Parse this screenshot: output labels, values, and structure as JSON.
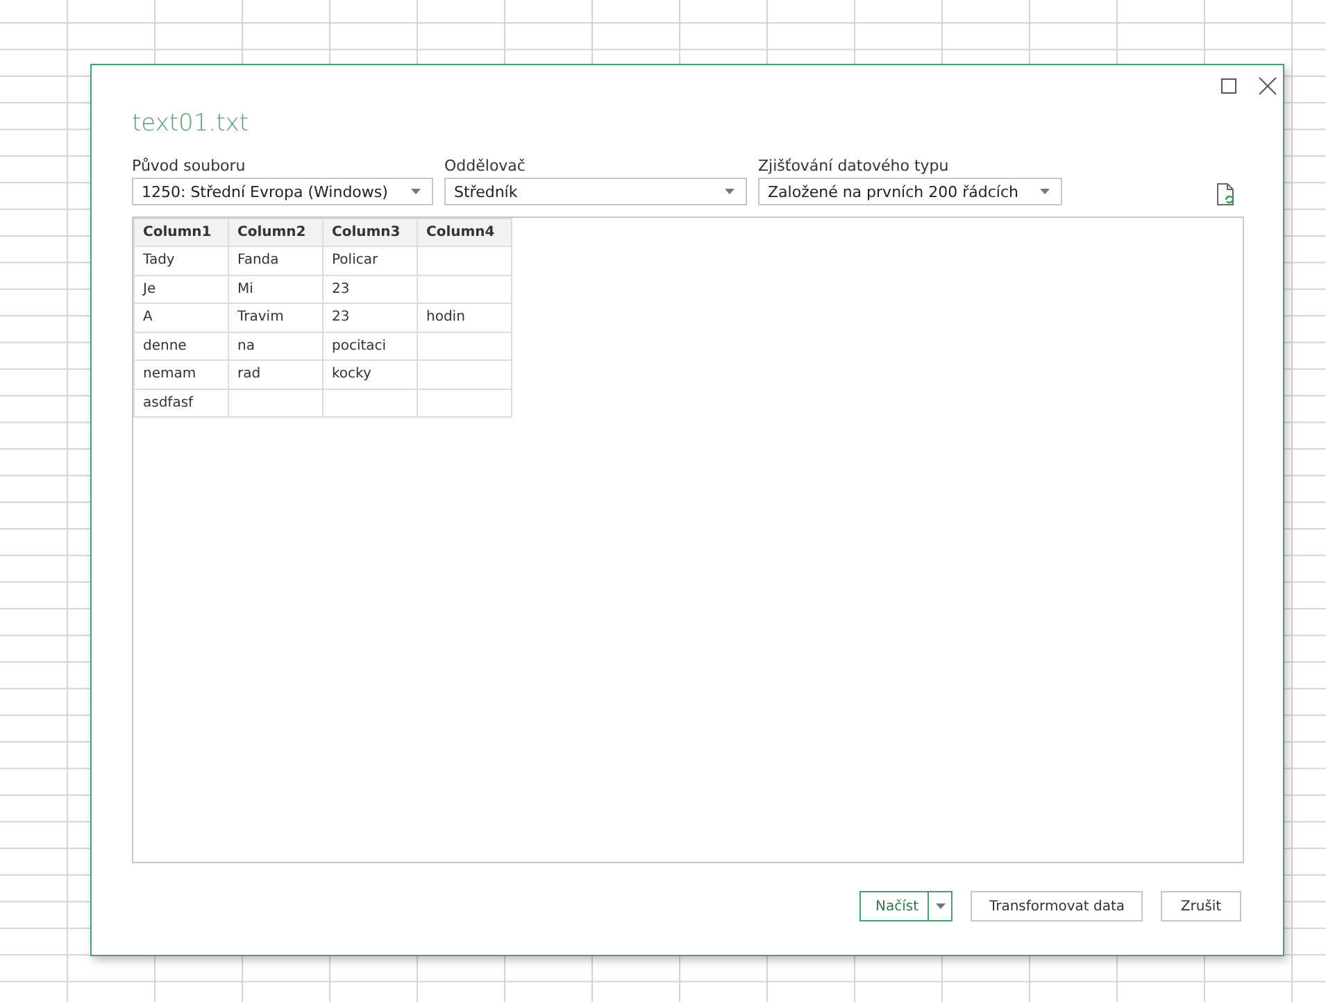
{
  "dialog": {
    "title": "text01.txt",
    "fields": [
      {
        "label": "Původ souboru",
        "value": "1250: Střední Evropa (Windows)"
      },
      {
        "label": "Oddělovač",
        "value": "Středník"
      },
      {
        "label": "Zjišťování datového typu",
        "value": "Založené na prvních 200 řádcích"
      }
    ],
    "table": {
      "columns": [
        "Column1",
        "Column2",
        "Column3",
        "Column4"
      ],
      "rows": [
        [
          "Tady",
          "Fanda",
          "Policar",
          ""
        ],
        [
          "Je",
          "Mi",
          "23",
          ""
        ],
        [
          "A",
          "Travim",
          "23",
          "hodin"
        ],
        [
          "denne",
          "na",
          "pocitaci",
          ""
        ],
        [
          "nemam",
          "rad",
          "kocky",
          ""
        ],
        [
          "asdfasf",
          "",
          "",
          ""
        ]
      ]
    },
    "buttons": [
      {
        "label": "Načíst",
        "kind": "split"
      },
      {
        "label": "Transformovat data",
        "kind": "plain"
      },
      {
        "label": "Zrušit",
        "kind": "plain"
      }
    ]
  }
}
